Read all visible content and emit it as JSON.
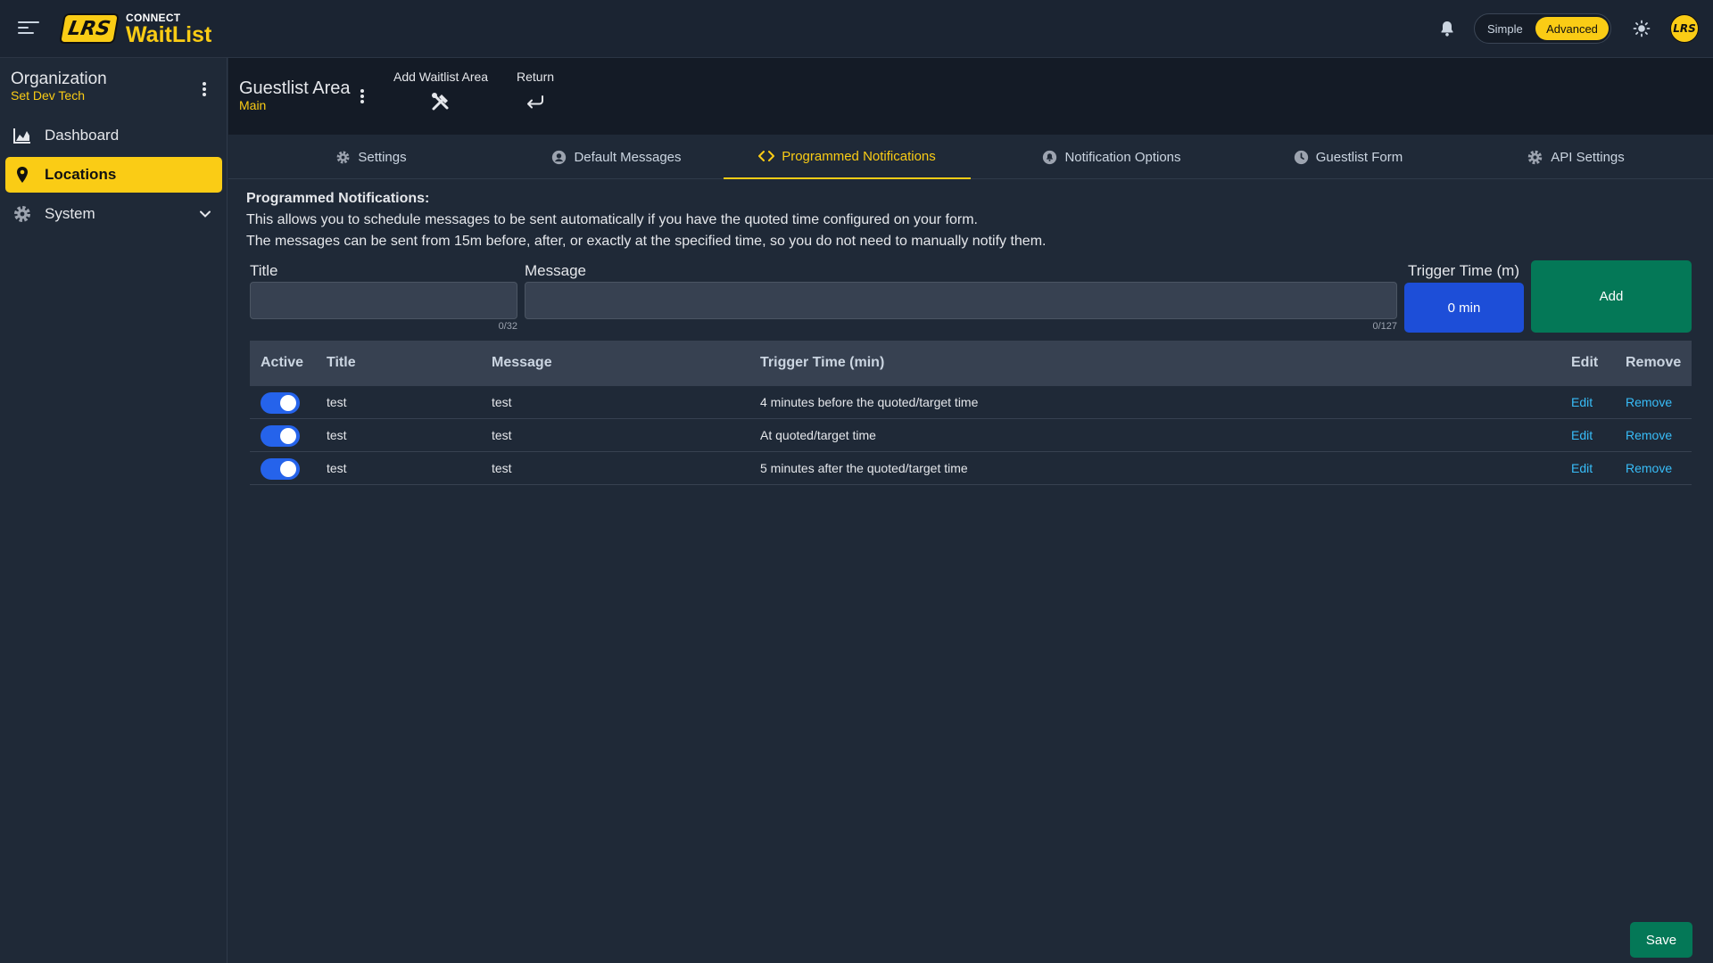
{
  "brand": {
    "logo_text": "LRS",
    "top": "CONNECT",
    "name": "WaitList"
  },
  "header": {
    "mode_simple": "Simple",
    "mode_advanced": "Advanced",
    "avatar_text": "LRS"
  },
  "sidebar": {
    "org_title": "Organization",
    "org_subtitle": "Set Dev Tech",
    "items": [
      {
        "label": "Dashboard",
        "icon": "chart-icon"
      },
      {
        "label": "Locations",
        "icon": "map-pin-icon",
        "active": true
      },
      {
        "label": "System",
        "icon": "gear-icon"
      }
    ]
  },
  "area": {
    "title": "Guestlist Area",
    "subtitle": "Main",
    "add_waitlist_area": "Add Waitlist Area",
    "return": "Return"
  },
  "tabs": [
    {
      "label": "Settings",
      "icon": "gear-icon"
    },
    {
      "label": "Default Messages",
      "icon": "user-circle-icon"
    },
    {
      "label": "Programmed Notifications",
      "icon": "code-icon",
      "active": true
    },
    {
      "label": "Notification Options",
      "icon": "bell-circle-icon"
    },
    {
      "label": "Guestlist Form",
      "icon": "clock-icon"
    },
    {
      "label": "API Settings",
      "icon": "gear-icon"
    }
  ],
  "intro": {
    "heading": "Programmed Notifications:",
    "line1": "This allows you to schedule messages to be sent automatically if you have the quoted time configured on your form.",
    "line2": "The messages can be sent from 15m before, after, or exactly at the specified time, so you do not need to manually notify them."
  },
  "form": {
    "title_label": "Title",
    "title_value": "",
    "title_counter": "0/32",
    "message_label": "Message",
    "message_value": "",
    "message_counter": "0/127",
    "trigger_label": "Trigger Time (m)",
    "trigger_value": "0 min",
    "add_label": "Add"
  },
  "table": {
    "headers": [
      "Active",
      "Title",
      "Message",
      "Trigger Time (min)",
      "Edit",
      "Remove"
    ],
    "rows": [
      {
        "active": true,
        "title": "test",
        "message": "test",
        "trigger": "4 minutes before the quoted/target time",
        "edit": "Edit",
        "remove": "Remove"
      },
      {
        "active": true,
        "title": "test",
        "message": "test",
        "trigger": "At quoted/target time",
        "edit": "Edit",
        "remove": "Remove"
      },
      {
        "active": true,
        "title": "test",
        "message": "test",
        "trigger": "5 minutes after the quoted/target time",
        "edit": "Edit",
        "remove": "Remove"
      }
    ]
  },
  "footer": {
    "save_label": "Save"
  },
  "colors": {
    "accent": "#facc15",
    "primary": "#1d4ed8",
    "success": "#047857",
    "link": "#38bdf8",
    "background": "#1f2937"
  }
}
